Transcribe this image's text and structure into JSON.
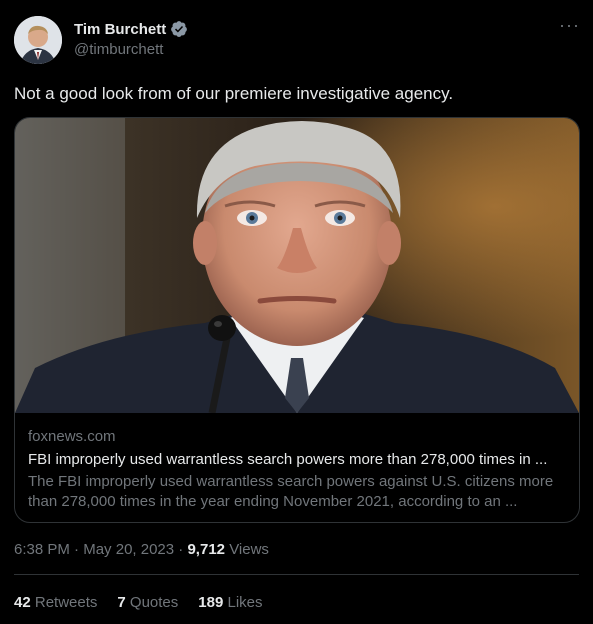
{
  "author": {
    "name": "Tim Burchett",
    "handle": "@timburchett"
  },
  "tweet": {
    "text": "Not a good look from of our premiere investigative agency."
  },
  "card": {
    "domain": "foxnews.com",
    "title": "FBI improperly used warrantless search powers more than 278,000 times in ...",
    "description_line1": "The FBI improperly used warrantless search powers against U.S. citizens more",
    "description_line2": "than 278,000 times in the year ending November 2021, according to an ..."
  },
  "meta": {
    "time": "6:38 PM",
    "date": "May 20, 2023",
    "views_count": "9,712",
    "views_label": "Views"
  },
  "stats": {
    "retweets_count": "42",
    "retweets_label": "Retweets",
    "quotes_count": "7",
    "quotes_label": "Quotes",
    "likes_count": "189",
    "likes_label": "Likes"
  },
  "colors": {
    "background": "#000000",
    "text_primary": "#e7e9ea",
    "text_secondary": "#71767b",
    "verified_badge": "#8b98a5",
    "border": "#2f3336"
  },
  "icons": {
    "verified": "verified-badge-icon",
    "more": "more-options-icon"
  }
}
